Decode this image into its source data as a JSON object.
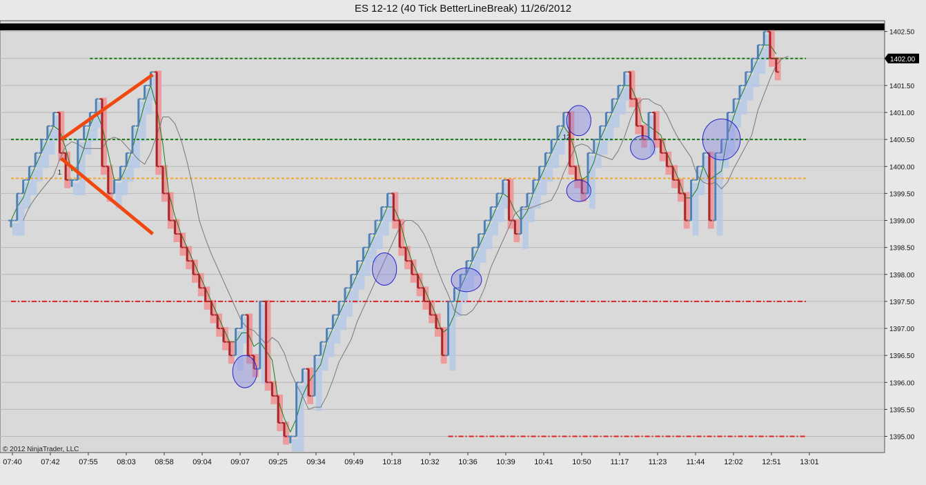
{
  "window": {
    "title": "ES 12-12 (40 Tick BetterLineBreak)  11/26/2012",
    "copyright": "© 2012 NinjaTrader, LLC"
  },
  "colors": {
    "background": "#d9d9d9",
    "up_bar": "#4f81b4",
    "down_bar": "#a5272b",
    "up_band": "#b4c8e6",
    "down_band": "#f08c8c",
    "green_level": "#0a7a0a",
    "orange_level": "#f5a623",
    "red_level": "#e02020",
    "grid": "#b8b8b8",
    "annotation_line": "#f04810",
    "circle_stroke": "#2222cc",
    "circle_fill": "#7a7ae8",
    "price_tag_bg": "#000000"
  },
  "chart_data": {
    "type": "line",
    "title": "ES 12-12 (40 Tick BetterLineBreak)  11/26/2012",
    "y_axis": {
      "ylim": [
        1394.7,
        1402.7
      ],
      "tick_labels": [
        "1402.50",
        "1402.00",
        "1401.50",
        "1401.00",
        "1400.50",
        "1400.00",
        "1399.50",
        "1399.00",
        "1398.50",
        "1398.00",
        "1397.50",
        "1397.00",
        "1396.50",
        "1396.00",
        "1395.50",
        "1395.00"
      ],
      "ticks": [
        1402.5,
        1402.0,
        1401.5,
        1401.0,
        1400.5,
        1400.0,
        1399.5,
        1399.0,
        1398.5,
        1398.0,
        1397.5,
        1397.0,
        1396.5,
        1396.0,
        1395.5,
        1395.0
      ],
      "last_price_label": "1402.00",
      "last_price": 1402.0
    },
    "x_axis": {
      "tick_labels": [
        "07:40",
        "07:42",
        "07:55",
        "08:03",
        "08:58",
        "09:04",
        "09:07",
        "09:25",
        "09:34",
        "09:49",
        "10:18",
        "10:32",
        "10:36",
        "10:39",
        "10:41",
        "10:50",
        "11:17",
        "11:23",
        "11:44",
        "12:02",
        "12:51",
        "13:01"
      ]
    },
    "grid": true,
    "levels": [
      {
        "name": "green",
        "price": 1402.0,
        "start_bar": 13
      },
      {
        "name": "green",
        "price": 1400.5,
        "start_bar": 0
      },
      {
        "name": "orange",
        "price": 1399.78,
        "start_bar": 0
      },
      {
        "name": "red",
        "price": 1397.5,
        "start_bar": 0
      },
      {
        "name": "red",
        "price": 1395.0,
        "start_bar": 72
      }
    ],
    "bars": [
      [
        1399.0,
        1399.0
      ],
      [
        1399.0,
        1399.5
      ],
      [
        1399.5,
        1399.75
      ],
      [
        1399.75,
        1400.0
      ],
      [
        1400.0,
        1400.25
      ],
      [
        1400.25,
        1400.5
      ],
      [
        1400.5,
        1400.75
      ],
      [
        1400.75,
        1401.0
      ],
      [
        1401.0,
        1400.25
      ],
      [
        1400.25,
        1399.75
      ],
      [
        1399.75,
        1399.75
      ],
      [
        1399.75,
        1400.5
      ],
      [
        1400.5,
        1400.75
      ],
      [
        1400.75,
        1401.0
      ],
      [
        1401.0,
        1401.25
      ],
      [
        1401.25,
        1400.0
      ],
      [
        1400.0,
        1399.5
      ],
      [
        1399.5,
        1399.75
      ],
      [
        1399.75,
        1400.0
      ],
      [
        1400.0,
        1400.25
      ],
      [
        1400.25,
        1400.75
      ],
      [
        1400.75,
        1401.25
      ],
      [
        1401.25,
        1401.5
      ],
      [
        1401.5,
        1401.75
      ],
      [
        1401.75,
        1400.0
      ],
      [
        1400.0,
        1399.5
      ],
      [
        1399.5,
        1399.0
      ],
      [
        1399.0,
        1398.75
      ],
      [
        1398.75,
        1398.5
      ],
      [
        1398.5,
        1398.25
      ],
      [
        1398.25,
        1398.0
      ],
      [
        1398.0,
        1397.75
      ],
      [
        1397.75,
        1397.5
      ],
      [
        1397.5,
        1397.25
      ],
      [
        1397.25,
        1397.0
      ],
      [
        1397.0,
        1396.75
      ],
      [
        1396.75,
        1396.5
      ],
      [
        1396.5,
        1397.0
      ],
      [
        1397.0,
        1397.25
      ],
      [
        1397.25,
        1396.5
      ],
      [
        1396.5,
        1396.25
      ],
      [
        1396.25,
        1397.5
      ],
      [
        1397.5,
        1396.0
      ],
      [
        1396.0,
        1395.75
      ],
      [
        1395.75,
        1395.25
      ],
      [
        1395.25,
        1395.0
      ],
      [
        1395.0,
        1395.0
      ],
      [
        1395.0,
        1396.0
      ],
      [
        1396.0,
        1396.25
      ],
      [
        1396.25,
        1395.75
      ],
      [
        1395.75,
        1396.5
      ],
      [
        1396.5,
        1396.75
      ],
      [
        1396.75,
        1397.0
      ],
      [
        1397.0,
        1397.25
      ],
      [
        1397.25,
        1397.5
      ],
      [
        1397.5,
        1397.75
      ],
      [
        1397.75,
        1398.0
      ],
      [
        1398.0,
        1398.25
      ],
      [
        1398.25,
        1398.5
      ],
      [
        1398.5,
        1398.75
      ],
      [
        1398.75,
        1399.0
      ],
      [
        1399.0,
        1399.25
      ],
      [
        1399.25,
        1399.5
      ],
      [
        1399.5,
        1399.0
      ],
      [
        1399.0,
        1398.5
      ],
      [
        1398.5,
        1398.25
      ],
      [
        1398.25,
        1398.0
      ],
      [
        1398.0,
        1397.75
      ],
      [
        1397.75,
        1397.5
      ],
      [
        1397.5,
        1397.25
      ],
      [
        1397.25,
        1397.0
      ],
      [
        1397.0,
        1396.5
      ],
      [
        1396.5,
        1397.5
      ],
      [
        1397.5,
        1397.75
      ],
      [
        1397.75,
        1398.0
      ],
      [
        1398.0,
        1398.25
      ],
      [
        1398.25,
        1398.5
      ],
      [
        1398.5,
        1398.75
      ],
      [
        1398.75,
        1399.0
      ],
      [
        1399.0,
        1399.25
      ],
      [
        1399.25,
        1399.5
      ],
      [
        1399.5,
        1399.75
      ],
      [
        1399.75,
        1399.0
      ],
      [
        1399.0,
        1398.75
      ],
      [
        1398.75,
        1399.25
      ],
      [
        1399.25,
        1399.5
      ],
      [
        1399.5,
        1399.75
      ],
      [
        1399.75,
        1400.0
      ],
      [
        1400.0,
        1400.25
      ],
      [
        1400.25,
        1400.5
      ],
      [
        1400.5,
        1400.75
      ],
      [
        1400.75,
        1401.0
      ],
      [
        1401.0,
        1400.0
      ],
      [
        1400.0,
        1399.75
      ],
      [
        1399.75,
        1399.5
      ],
      [
        1399.5,
        1400.25
      ],
      [
        1400.25,
        1400.5
      ],
      [
        1400.5,
        1400.75
      ],
      [
        1400.75,
        1401.0
      ],
      [
        1401.0,
        1401.25
      ],
      [
        1401.25,
        1401.5
      ],
      [
        1401.5,
        1401.75
      ],
      [
        1401.75,
        1401.25
      ],
      [
        1401.25,
        1400.75
      ],
      [
        1400.75,
        1400.5
      ],
      [
        1400.5,
        1401.0
      ],
      [
        1401.0,
        1400.5
      ],
      [
        1400.5,
        1400.25
      ],
      [
        1400.25,
        1400.0
      ],
      [
        1400.0,
        1399.75
      ],
      [
        1399.75,
        1399.5
      ],
      [
        1399.5,
        1399.0
      ],
      [
        1399.0,
        1399.75
      ],
      [
        1399.75,
        1400.0
      ],
      [
        1400.0,
        1400.25
      ],
      [
        1400.25,
        1399.0
      ],
      [
        1399.0,
        1400.25
      ],
      [
        1400.25,
        1400.5
      ],
      [
        1400.5,
        1401.0
      ],
      [
        1401.0,
        1401.25
      ],
      [
        1401.25,
        1401.5
      ],
      [
        1401.5,
        1401.75
      ],
      [
        1401.75,
        1402.0
      ],
      [
        1402.0,
        1402.25
      ],
      [
        1402.25,
        1402.5
      ],
      [
        1402.5,
        1402.0
      ],
      [
        1402.0,
        1401.75
      ]
    ],
    "annotations": {
      "lines": [
        {
          "from": [
            2,
            1400.5
          ],
          "to": [
            8,
            1401.7
          ]
        },
        {
          "from": [
            2,
            1400.15
          ],
          "to": [
            8,
            1398.75
          ]
        }
      ],
      "circles": [
        {
          "bar": 38.5,
          "price": 1396.2,
          "rx": 2,
          "ry": 0.3
        },
        {
          "bar": 61.5,
          "price": 1398.1,
          "rx": 2,
          "ry": 0.3
        },
        {
          "bar": 75,
          "price": 1397.9,
          "rx": 2.5,
          "ry": 0.22
        },
        {
          "bar": 93.5,
          "price": 1400.85,
          "rx": 2,
          "ry": 0.28
        },
        {
          "bar": 93.5,
          "price": 1399.55,
          "rx": 2,
          "ry": 0.2
        },
        {
          "bar": 104,
          "price": 1400.35,
          "rx": 2,
          "ry": 0.22
        },
        {
          "bar": 117,
          "price": 1400.5,
          "rx": 3.1,
          "ry": 0.38
        }
      ],
      "texts": [
        {
          "text": "1",
          "bar": 8,
          "price": 1399.85
        },
        {
          "text": "12",
          "bar": 91.5,
          "price": 1400.5
        }
      ]
    }
  }
}
